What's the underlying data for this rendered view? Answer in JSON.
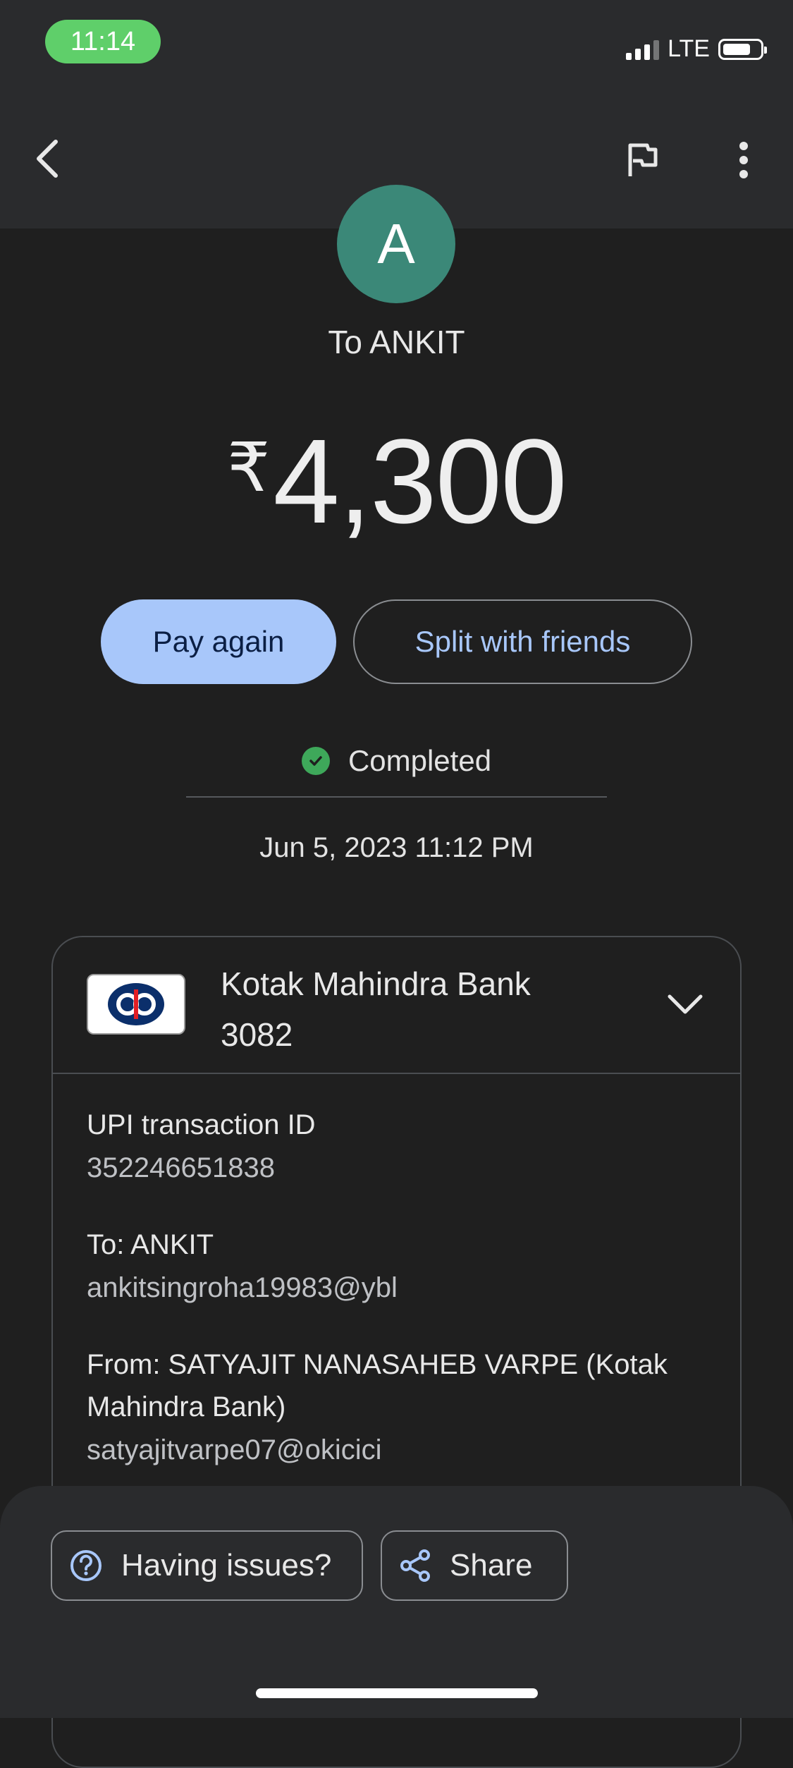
{
  "status_bar": {
    "time": "11:14",
    "network": "LTE"
  },
  "header": {
    "back_icon": "chevron-left-icon",
    "flag_icon": "flag-icon",
    "more_icon": "more-vertical-icon"
  },
  "payee": {
    "avatar_letter": "A",
    "to_label": "To ANKIT",
    "avatar_color": "#3b8878"
  },
  "amount": {
    "currency": "₹",
    "value": "4,300"
  },
  "actions": {
    "pay_again": "Pay again",
    "split": "Split with friends"
  },
  "status": {
    "text": "Completed",
    "datetime": "Jun 5, 2023 11:12 PM",
    "color": "#3ea85a"
  },
  "account": {
    "bank_name": "Kotak Mahindra Bank",
    "account_suffix": "3082"
  },
  "details": [
    {
      "label": "UPI transaction ID",
      "value": "352246651838"
    },
    {
      "label": "To: ANKIT",
      "value": "ankitsingroha19983@ybl"
    },
    {
      "label": "From: SATYAJIT NANASAHEB VARPE (Kotak Mahindra Bank)",
      "value": "satyajitvarpe07@okicici"
    }
  ],
  "footer": {
    "issues_label": "Having issues?",
    "share_label": "Share"
  },
  "colors": {
    "accent": "#a8c7fa",
    "background": "#1f1f1f"
  }
}
